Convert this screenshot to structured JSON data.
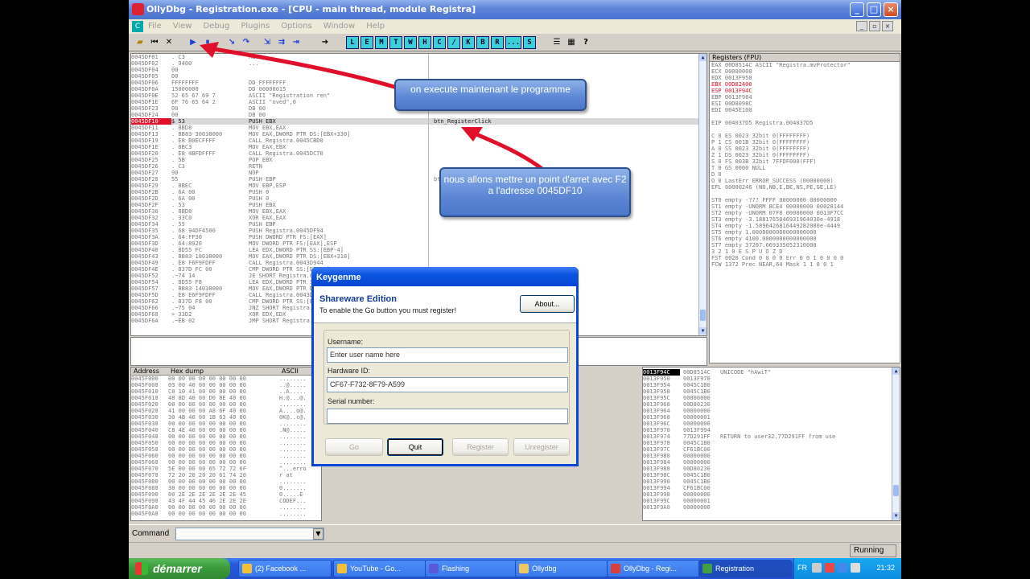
{
  "window": {
    "title": "OllyDbg - Registration.exe - [CPU - main thread, module Registra]",
    "controls": [
      "_",
      "□",
      "×"
    ]
  },
  "menu": [
    "File",
    "View",
    "Debug",
    "Plugins",
    "Options",
    "Window",
    "Help"
  ],
  "toolbar": {
    "letters": [
      "L",
      "E",
      "M",
      "T",
      "W",
      "H",
      "C",
      "/",
      "K",
      "B",
      "R",
      "...",
      "S"
    ]
  },
  "disasm": {
    "rows": [
      {
        "addr": "0045DF01",
        "hex": ". C3",
        "cmd": "RETN",
        "cmt": ""
      },
      {
        "addr": "0045DF02",
        "hex": ". 9400",
        "cmd": "...",
        "cmt": ""
      },
      {
        "addr": "0045DF04",
        "hex": "  00",
        "cmd": "",
        "cmt": ""
      },
      {
        "addr": "0045DF05",
        "hex": "  00",
        "cmd": "",
        "cmt": ""
      },
      {
        "addr": "0045DF06",
        "hex": "  FFFFFFFF",
        "cmd": "DD FFFFFFFF",
        "cmt": ""
      },
      {
        "addr": "0045DF0A",
        "hex": "  15000000",
        "cmd": "DD 00000015",
        "cmt": ""
      },
      {
        "addr": "0045DF0E",
        "hex": "  52 65 67 69 7",
        "cmd": "ASCII \"Registration ren\"",
        "cmt": ""
      },
      {
        "addr": "0045DF1E",
        "hex": "  6F 76 65 64 2",
        "cmd": "ASCII \"oved\",0",
        "cmt": ""
      },
      {
        "addr": "0045DF23",
        "hex": "  00",
        "cmd": "DB 00",
        "cmt": ""
      },
      {
        "addr": "0045DF24",
        "hex": "  00",
        "cmd": "DB 00",
        "cmt": ""
      },
      {
        "addr": "0045DF10",
        "hex": "$ 53",
        "cmd": "PUSH EBX",
        "cmt": "btn_RegisterClick"
      },
      {
        "addr": "0045DF11",
        "hex": ". 8BD8",
        "cmd": "MOV EBX,EAX",
        "cmt": ""
      },
      {
        "addr": "0045DF13",
        "hex": ". 8B83 30030000",
        "cmd": "MOV EAX,DWORD PTR DS:[EBX+330]",
        "cmt": ""
      },
      {
        "addr": "0045DF19",
        "hex": ". E8 B0ECFFFF",
        "cmd": "CALL Registra.0045CBD0",
        "cmt": ""
      },
      {
        "addr": "0045DF1E",
        "hex": ". 8BC3",
        "cmd": "MOV EAX,EBX",
        "cmt": ""
      },
      {
        "addr": "0045DF20",
        "hex": ". E8 4BFDFFFF",
        "cmd": "CALL Registra.0045DC70",
        "cmt": ""
      },
      {
        "addr": "0045DF25",
        "hex": ". 5B",
        "cmd": "POP EBX",
        "cmt": ""
      },
      {
        "addr": "0045DF26",
        "hex": ". C3",
        "cmd": "RETN",
        "cmt": ""
      },
      {
        "addr": "0045DF27",
        "hex": "  90",
        "cmd": "NOP",
        "cmt": ""
      },
      {
        "addr": "0045DF28",
        "hex": "  55",
        "cmd": "PUSH EBP",
        "cmt": "btn_"
      },
      {
        "addr": "0045DF29",
        "hex": ". 8BEC",
        "cmd": "MOV EBP,ESP",
        "cmt": ""
      },
      {
        "addr": "0045DF2B",
        "hex": ". 6A 00",
        "cmd": "PUSH 0",
        "cmt": ""
      },
      {
        "addr": "0045DF2D",
        "hex": ". 6A 00",
        "cmd": "PUSH 0",
        "cmt": ""
      },
      {
        "addr": "0045DF2F",
        "hex": ". 53",
        "cmd": "PUSH EBX",
        "cmt": ""
      },
      {
        "addr": "0045DF30",
        "hex": ". 8BD8",
        "cmd": "MOV EBX,EAX",
        "cmt": ""
      },
      {
        "addr": "0045DF32",
        "hex": ". 33C0",
        "cmd": "XOR EAX,EAX",
        "cmt": ""
      },
      {
        "addr": "0045DF34",
        "hex": ". 55",
        "cmd": "PUSH EBP",
        "cmt": ""
      },
      {
        "addr": "0045DF35",
        "hex": ". 68 94DF4500",
        "cmd": "PUSH Registra.0045DF94",
        "cmt": ""
      },
      {
        "addr": "0045DF3A",
        "hex": ". 64:FF30",
        "cmd": "PUSH DWORD PTR FS:[EAX]",
        "cmt": ""
      },
      {
        "addr": "0045DF3D",
        "hex": ". 64:8920",
        "cmd": "MOV DWORD PTR FS:[EAX],ESP",
        "cmt": ""
      },
      {
        "addr": "0045DF40",
        "hex": ". 8D55 FC",
        "cmd": "LEA EDX,DWORD PTR SS:[EBP-4]",
        "cmt": ""
      },
      {
        "addr": "0045DF43",
        "hex": ". 8B83 18030000",
        "cmd": "MOV EAX,DWORD PTR DS:[EBX+318]",
        "cmt": ""
      },
      {
        "addr": "0045DF49",
        "hex": ". E8 F6F9FDFF",
        "cmd": "CALL Registra.0043D944",
        "cmt": ""
      },
      {
        "addr": "0045DF4E",
        "hex": ". 837D FC 00",
        "cmd": "CMP DWORD PTR SS:[EBP-4],0",
        "cmt": ""
      },
      {
        "addr": "0045DF52",
        "hex": ".~74 14",
        "cmd": "JE SHORT Registra.0045DF68",
        "cmt": ""
      },
      {
        "addr": "0045DF54",
        "hex": ". 8D55 F8",
        "cmd": "LEA EDX,DWORD PTR SS:[EBP-8]",
        "cmt": ""
      },
      {
        "addr": "0045DF57",
        "hex": ". 8B83 14030000",
        "cmd": "MOV EAX,DWORD PTR DS:[EBX+314]",
        "cmt": ""
      },
      {
        "addr": "0045DF5D",
        "hex": ". E8 E6F9FDFF",
        "cmd": "CALL Registra.0043D948",
        "cmt": ""
      },
      {
        "addr": "0045DF62",
        "hex": ". 837D F8 00",
        "cmd": "CMP DWORD PTR SS:[EBP-8],0",
        "cmt": ""
      },
      {
        "addr": "0045DF66",
        "hex": ".~75 04",
        "cmd": "JNZ SHORT Registra.0045DF6C",
        "cmt": ""
      },
      {
        "addr": "0045DF68",
        "hex": "> 33D2",
        "cmd": "XOR EDX,EDX",
        "cmt": ""
      },
      {
        "addr": "0045DF6A",
        "hex": ".~EB 02",
        "cmd": "JMP SHORT Registra.0045DF6E",
        "cmt": ""
      }
    ]
  },
  "registers": {
    "header": "Registers (FPU)",
    "lines": [
      {
        "text": "EAX 00D8514C ASCII \"Registra.mvProtector\"",
        "highlight": false
      },
      {
        "text": "ECX 00000000",
        "highlight": false
      },
      {
        "text": "EDX 0013F958",
        "highlight": false
      },
      {
        "text": "EBX 00D82400",
        "highlight": true
      },
      {
        "text": "ESP 0013F94C",
        "highlight": true
      },
      {
        "text": "EBP 0013F984",
        "highlight": false
      },
      {
        "text": "ESI 00D8098C",
        "highlight": false
      },
      {
        "text": "EDI 0045E100",
        "highlight": false
      },
      {
        "text": "",
        "highlight": false
      },
      {
        "text": "EIP 004037D5 Registra.004037D5",
        "highlight": false
      },
      {
        "text": "",
        "highlight": false
      },
      {
        "text": "C 0  ES 0023 32bit 0(FFFFFFFF)",
        "highlight": false
      },
      {
        "text": "P 1  CS 001B 32bit 0(FFFFFFFF)",
        "highlight": false
      },
      {
        "text": "A 0  SS 0023 32bit 0(FFFFFFFF)",
        "highlight": false
      },
      {
        "text": "Z 1  DS 0023 32bit 0(FFFFFFFF)",
        "highlight": false
      },
      {
        "text": "S 0  FS 003B 32bit 7FFDF000(FFF)",
        "highlight": false
      },
      {
        "text": "T 0  GS 0000 NULL",
        "highlight": false
      },
      {
        "text": "D 0",
        "highlight": false
      },
      {
        "text": "O 0  LastErr ERROR_SUCCESS (00000000)",
        "highlight": false
      },
      {
        "text": "EFL 00000246 (NO,NB,E,BE,NS,PE,GE,LE)",
        "highlight": false
      },
      {
        "text": "",
        "highlight": false
      },
      {
        "text": "ST0 empty -??? FFFF 00000000 00000000",
        "highlight": false
      },
      {
        "text": "ST1 empty -UNORM BCE4 00000000 00028144",
        "highlight": false
      },
      {
        "text": "ST2 empty -UNORM 07F8 00000000 0013F7CC",
        "highlight": false
      },
      {
        "text": "ST3 empty -3.1881765046931964030e-4918",
        "highlight": false
      },
      {
        "text": "ST4 empty -1.5896426816449282080e-4449",
        "highlight": false
      },
      {
        "text": "ST5 empty 1.0000000000000000000",
        "highlight": false
      },
      {
        "text": "ST6 empty 4100.0000000000000000",
        "highlight": false
      },
      {
        "text": "ST7 empty 37207.669335052310000",
        "highlight": false
      },
      {
        "text": "               3 2 1 0      E S P U O Z D",
        "highlight": false
      },
      {
        "text": "FST 0020  Cond 0 0 0 0  Err 0 0 1 0 0 0 0",
        "highlight": false
      },
      {
        "text": "FCW 1372  Prec NEAR,64  Mask    1 1 0 0 1",
        "highlight": false
      }
    ]
  },
  "dump": {
    "headers": [
      "Address",
      "Hex dump",
      "ASCII"
    ],
    "rows": [
      {
        "addr": "0045F000",
        "hex": "00 00 00 00 00 00 00 00",
        "ascii": "........"
      },
      {
        "addr": "0045F008",
        "hex": "03 00 40 00 00 00 00 00",
        "ascii": "..@....."
      },
      {
        "addr": "0045F010",
        "hex": "C0 10 41 00 00 00 00 00",
        "ascii": "..A....."
      },
      {
        "addr": "0045F018",
        "hex": "48 8D 40 00 D0 8E 40 00",
        "ascii": "H.@...@."
      },
      {
        "addr": "0045F020",
        "hex": "00 00 00 00 00 00 00 00",
        "ascii": "........"
      },
      {
        "addr": "0045F028",
        "hex": "41 00 00 00 A8 6F 40 00",
        "ascii": "A....o@."
      },
      {
        "addr": "0045F030",
        "hex": "30 4B 40 00 1B 63 40 00",
        "ascii": "0K@..c@."
      },
      {
        "addr": "0045F038",
        "hex": "00 00 00 00 00 00 00 00",
        "ascii": "........"
      },
      {
        "addr": "0045F040",
        "hex": "C8 4E 40 00 00 00 00 00",
        "ascii": ".N@....."
      },
      {
        "addr": "0045F048",
        "hex": "00 00 00 00 00 00 00 00",
        "ascii": "........"
      },
      {
        "addr": "0045F050",
        "hex": "00 00 00 00 00 00 00 00",
        "ascii": "........"
      },
      {
        "addr": "0045F058",
        "hex": "00 00 00 00 00 00 00 00",
        "ascii": "........"
      },
      {
        "addr": "0045F060",
        "hex": "00 00 00 00 00 00 00 00",
        "ascii": "........"
      },
      {
        "addr": "0045F068",
        "hex": "00 00 00 00 00 00 00 00",
        "ascii": "........"
      },
      {
        "addr": "0045F070",
        "hex": "5E 00 00 00 65 72 72 6F",
        "ascii": "^...erro"
      },
      {
        "addr": "0045F078",
        "hex": "72 20 20 20 20 61 74 20",
        "ascii": "r    at "
      },
      {
        "addr": "0045F080",
        "hex": "00 00 00 00 00 00 00 00",
        "ascii": "........"
      },
      {
        "addr": "0045F088",
        "hex": "30 00 00 00 00 00 00 00",
        "ascii": "0......."
      },
      {
        "addr": "0045F090",
        "hex": "00 2E 2E 2E 2E 2E 2E 45",
        "ascii": "0.....E"
      },
      {
        "addr": "0045F098",
        "hex": "43 4F 44 45 46 2E 2E 2E",
        "ascii": "CODEF..."
      },
      {
        "addr": "0045F0A0",
        "hex": "00 00 00 00 00 00 00 00",
        "ascii": "........"
      },
      {
        "addr": "0045F0A8",
        "hex": "00 00 00 00 00 00 00 00",
        "ascii": "........"
      }
    ]
  },
  "stack": {
    "rows": [
      {
        "addr": "0013F94C",
        "val": "00D8514C",
        "cmt": "UNICODE \"hAwiT\"",
        "active": true
      },
      {
        "addr": "0013F950",
        "val": "0013F970",
        "cmt": "",
        "active": false
      },
      {
        "addr": "0013F954",
        "val": "0045C1B0",
        "cmt": "",
        "active": false
      },
      {
        "addr": "0013F958",
        "val": "0045C1B0",
        "cmt": "",
        "active": false
      },
      {
        "addr": "0013F95C",
        "val": "00000000",
        "cmt": "",
        "active": false
      },
      {
        "addr": "0013F960",
        "val": "00D80230",
        "cmt": "",
        "active": false
      },
      {
        "addr": "0013F964",
        "val": "00000000",
        "cmt": "",
        "active": false
      },
      {
        "addr": "0013F968",
        "val": "00000001",
        "cmt": "",
        "active": false
      },
      {
        "addr": "0013F96C",
        "val": "00000000",
        "cmt": "",
        "active": false
      },
      {
        "addr": "0013F970",
        "val": "0013F994",
        "cmt": "",
        "active": false
      },
      {
        "addr": "0013F974",
        "val": "77D291FF",
        "cmt": "RETURN to user32.77D291FF from use",
        "active": false
      },
      {
        "addr": "0013F978",
        "val": "0045C1B0",
        "cmt": "",
        "active": false
      },
      {
        "addr": "0013F97C",
        "val": "CF61BC00",
        "cmt": "",
        "active": false
      },
      {
        "addr": "0013F980",
        "val": "00000000",
        "cmt": "",
        "active": false
      },
      {
        "addr": "0013F984",
        "val": "00000000",
        "cmt": "",
        "active": false
      },
      {
        "addr": "0013F988",
        "val": "00D80230",
        "cmt": "",
        "active": false
      },
      {
        "addr": "0013F98C",
        "val": "0045C1B0",
        "cmt": "",
        "active": false
      },
      {
        "addr": "0013F990",
        "val": "0045C1B0",
        "cmt": "",
        "active": false
      },
      {
        "addr": "0013F994",
        "val": "CF61BC00",
        "cmt": "",
        "active": false
      },
      {
        "addr": "0013F998",
        "val": "00000000",
        "cmt": "",
        "active": false
      },
      {
        "addr": "0013F99C",
        "val": "00000001",
        "cmt": "",
        "active": false
      },
      {
        "addr": "0013F9A0",
        "val": "00000000",
        "cmt": "",
        "active": false
      }
    ]
  },
  "callouts": {
    "first": "on execute maintenant le programme",
    "second": "nous allons mettre un point d'arret avec F2 a l'adresse 0045DF10"
  },
  "keygen": {
    "title": "Keygenme",
    "header_title": "Shareware Edition",
    "header_sub": "To enable the Go button you must register!",
    "about_label": "About...",
    "username_label": "Username:",
    "username_value": "Enter user name here",
    "hwid_label": "Hardware ID:",
    "hwid_value": "CF67-F732-8F79-A599",
    "serial_label": "Serial number:",
    "serial_value": "",
    "go_label": "Go",
    "quit_label": "Quit",
    "register_label": "Register",
    "unregister_label": "Unregister"
  },
  "command": {
    "label": "Command",
    "value": ""
  },
  "status": {
    "text": "Running"
  },
  "taskbar": {
    "start_label": "démarrer",
    "tasks": [
      {
        "label": "(2) Facebook ...",
        "color": "#f3c234"
      },
      {
        "label": "YouTube - Go...",
        "color": "#f3c234"
      },
      {
        "label": "Flashing",
        "color": "#5a5ad8"
      },
      {
        "label": "Ollydbg",
        "color": "#f0c860"
      },
      {
        "label": "OllyDbg - Regi...",
        "color": "#d84040"
      },
      {
        "label": "Registration",
        "color": "#40a040"
      }
    ],
    "lang": "FR",
    "clock": "21:32"
  },
  "colors": {
    "accent": "#0a46d6",
    "highlight_red": "#e0102a",
    "arrow_red": "#e0102a"
  }
}
